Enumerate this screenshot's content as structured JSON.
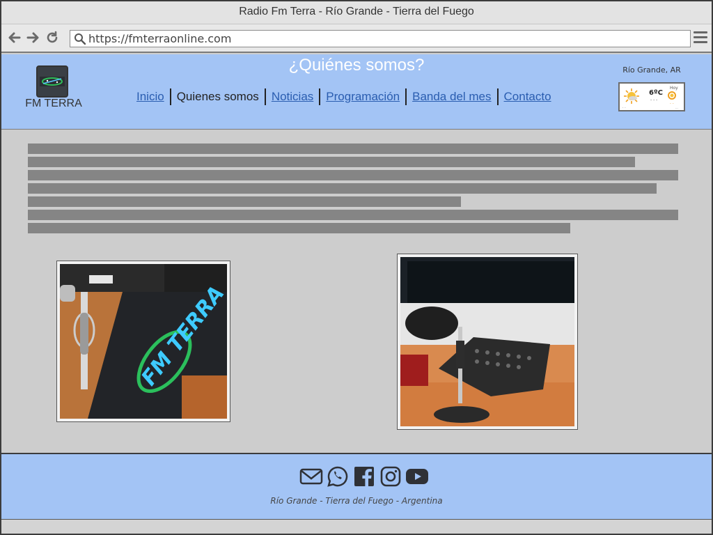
{
  "browser": {
    "window_title": "Radio Fm Terra - Río Grande - Tierra del Fuego",
    "url": "https://fmterraonline.com"
  },
  "header": {
    "logo_title": "FM TERRA",
    "page_heading": "¿Quiénes somos?",
    "menu": [
      {
        "label": "Inicio",
        "active": false
      },
      {
        "label": "Quienes somos",
        "active": true
      },
      {
        "label": "Noticias",
        "active": false
      },
      {
        "label": "Programación",
        "active": false
      },
      {
        "label": "Banda del mes",
        "active": false
      },
      {
        "label": "Contacto",
        "active": false
      }
    ],
    "weather": {
      "location": "Río Grande, AR",
      "temperature": "6ºC",
      "day_label": "Hoy"
    }
  },
  "content": {
    "paragraph_lines": 7,
    "photos": [
      {
        "icon": "studio-microphone-logo-photo"
      },
      {
        "icon": "mixer-console-photo"
      }
    ]
  },
  "footer": {
    "social_icons": [
      "email-icon",
      "whatsapp-icon",
      "facebook-icon",
      "instagram-icon",
      "youtube-icon"
    ],
    "location_text": "Río Grande - Tierra del Fuego - Argentina"
  },
  "colors": {
    "header_bg": "#a3c4f5",
    "content_bg": "#cdcdcd",
    "link": "#2a5db0",
    "placeholder_text": "#858585"
  }
}
